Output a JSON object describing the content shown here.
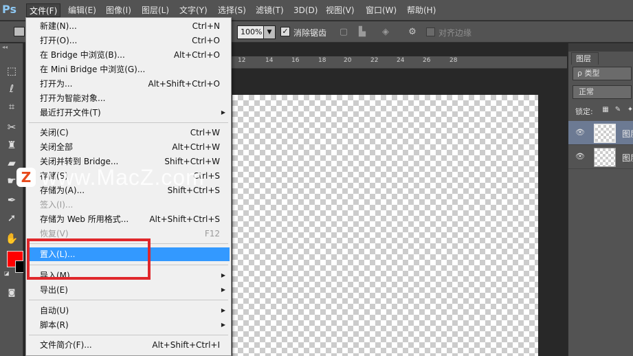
{
  "app": {
    "logo": "Ps"
  },
  "menubar": [
    "文件(F)",
    "编辑(E)",
    "图像(I)",
    "图层(L)",
    "文字(Y)",
    "选择(S)",
    "滤镜(T)",
    "3D(D)",
    "视图(V)",
    "窗口(W)",
    "帮助(H)"
  ],
  "options": {
    "opacity": "100%",
    "antialias_label": "消除锯齿",
    "align_label": "对齐边缘"
  },
  "ruler": [
    "12",
    "14",
    "16",
    "18",
    "20",
    "22",
    "24",
    "26",
    "28"
  ],
  "layers_panel": {
    "tab": "图层",
    "filter": "ρ 类型",
    "blend_mode": "正常",
    "lock_label": "锁定:",
    "layers": [
      {
        "name": "图层",
        "selected": true
      },
      {
        "name": "图层",
        "selected": false
      }
    ]
  },
  "file_menu": {
    "items": [
      {
        "label": "新建(N)...",
        "shortcut": "Ctrl+N"
      },
      {
        "label": "打开(O)...",
        "shortcut": "Ctrl+O"
      },
      {
        "label": "在 Bridge 中浏览(B)...",
        "shortcut": "Alt+Ctrl+O"
      },
      {
        "label": "在 Mini Bridge 中浏览(G)...",
        "shortcut": ""
      },
      {
        "label": "打开为...",
        "shortcut": "Alt+Shift+Ctrl+O"
      },
      {
        "label": "打开为智能对象...",
        "shortcut": ""
      },
      {
        "label": "最近打开文件(T)",
        "shortcut": "",
        "submenu": true
      },
      {
        "label": "关闭(C)",
        "shortcut": "Ctrl+W"
      },
      {
        "label": "关闭全部",
        "shortcut": "Alt+Ctrl+W"
      },
      {
        "label": "关闭并转到 Bridge...",
        "shortcut": "Shift+Ctrl+W"
      },
      {
        "label": "存储(S)",
        "shortcut": "Ctrl+S"
      },
      {
        "label": "存储为(A)...",
        "shortcut": "Shift+Ctrl+S"
      },
      {
        "label": "签入(I)...",
        "shortcut": "",
        "disabled": true
      },
      {
        "label": "存储为 Web 所用格式...",
        "shortcut": "Alt+Shift+Ctrl+S"
      },
      {
        "label": "恢复(V)",
        "shortcut": "F12",
        "disabled": true
      },
      {
        "label": "置入(L)...",
        "shortcut": "",
        "highlight": true
      },
      {
        "label": "导入(M)",
        "shortcut": "",
        "submenu": true
      },
      {
        "label": "导出(E)",
        "shortcut": "",
        "submenu": true
      },
      {
        "label": "自动(U)",
        "shortcut": "",
        "submenu": true
      },
      {
        "label": "脚本(R)",
        "shortcut": "",
        "submenu": true
      },
      {
        "label": "文件简介(F)...",
        "shortcut": "Alt+Shift+Ctrl+I"
      }
    ]
  },
  "watermark": {
    "text": "www.MacZ.com",
    "logo": "Z"
  },
  "colors": {
    "foreground": "#ff0000",
    "background": "#000000",
    "highlight": "#3399ff",
    "annotation": "#e0272b"
  },
  "icons": [
    "marquee-icon",
    "lasso-icon",
    "crop-icon",
    "healing-icon",
    "stamp-icon",
    "eraser-icon",
    "smudge-icon",
    "pen-icon",
    "path-select-icon",
    "hand-icon",
    "quickmask-icon"
  ]
}
